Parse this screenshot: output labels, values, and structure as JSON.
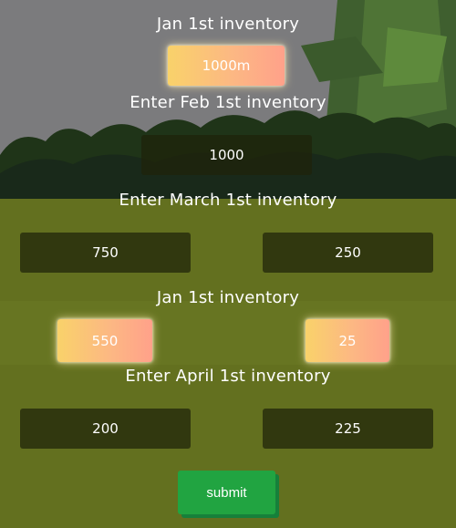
{
  "rows": [
    {
      "label": "Jan 1st inventory",
      "values": [
        "1000m"
      ]
    },
    {
      "label": "Enter Feb 1st inventory",
      "values": [
        "1000"
      ]
    },
    {
      "label": "Enter March 1st inventory",
      "values": [
        "750",
        "250"
      ]
    },
    {
      "label": "Jan 1st inventory",
      "values": [
        "550",
        "25"
      ]
    },
    {
      "label": "Enter April 1st inventory",
      "values": [
        "200",
        "225"
      ]
    }
  ],
  "submit_label": "submit",
  "colors": {
    "token_gradient_start": "#f9d26a",
    "token_gradient_end": "#ffa18a",
    "input_bg": "#2a2f0f",
    "submit_bg": "#21a441"
  }
}
